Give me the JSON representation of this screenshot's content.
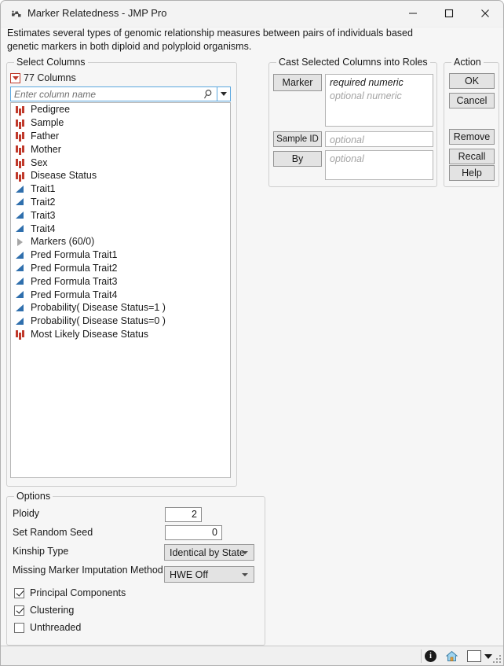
{
  "window": {
    "title": "Marker Relatedness - JMP Pro",
    "app_icon": "jmp-marker-icon",
    "minimize_label": "–",
    "maximize_label": "□",
    "close_label": "✕"
  },
  "description": "Estimates several types of genomic relationship measures between pairs of individuals based genetic markers in both diploid and polyploid organisms.",
  "select_columns": {
    "group_title": "Select Columns",
    "columns_count_label": "77 Columns",
    "search": {
      "placeholder": "Enter column name",
      "value": ""
    },
    "items": [
      {
        "label": "Pedigree",
        "type": "nominal"
      },
      {
        "label": "Sample",
        "type": "nominal"
      },
      {
        "label": "Father",
        "type": "nominal"
      },
      {
        "label": "Mother",
        "type": "nominal"
      },
      {
        "label": "Sex",
        "type": "nominal"
      },
      {
        "label": "Disease Status",
        "type": "nominal"
      },
      {
        "label": "Trait1",
        "type": "continuous"
      },
      {
        "label": "Trait2",
        "type": "continuous"
      },
      {
        "label": "Trait3",
        "type": "continuous"
      },
      {
        "label": "Trait4",
        "type": "continuous"
      },
      {
        "label": "Markers (60/0)",
        "type": "group"
      },
      {
        "label": "Pred Formula Trait1",
        "type": "continuous"
      },
      {
        "label": "Pred Formula Trait2",
        "type": "continuous"
      },
      {
        "label": "Pred Formula Trait3",
        "type": "continuous"
      },
      {
        "label": "Pred Formula Trait4",
        "type": "continuous"
      },
      {
        "label": "Probability( Disease Status=1 )",
        "type": "continuous"
      },
      {
        "label": "Probability( Disease Status=0 )",
        "type": "continuous"
      },
      {
        "label": "Most Likely Disease Status",
        "type": "nominal"
      }
    ]
  },
  "cast_roles": {
    "group_title": "Cast Selected Columns into Roles",
    "marker": {
      "button_label": "Marker",
      "hint_required": "required numeric",
      "hint_optional": "optional numeric",
      "value": ""
    },
    "sample_id": {
      "button_label": "Sample ID",
      "hint": "optional",
      "value": ""
    },
    "by": {
      "button_label": "By",
      "hint": "optional",
      "value": ""
    }
  },
  "action": {
    "group_title": "Action",
    "ok": "OK",
    "cancel": "Cancel",
    "remove": "Remove",
    "recall": "Recall",
    "help": "Help"
  },
  "options": {
    "group_title": "Options",
    "ploidy": {
      "label": "Ploidy",
      "value": "2"
    },
    "random_seed": {
      "label": "Set Random Seed",
      "value": "0"
    },
    "kinship_type": {
      "label": "Kinship Type",
      "value": "Identical by State"
    },
    "imputation_method": {
      "label": "Missing Marker Imputation Method",
      "value": "HWE Off"
    },
    "checkboxes": [
      {
        "label": "Principal Components",
        "checked": true
      },
      {
        "label": "Clustering",
        "checked": true
      },
      {
        "label": "Unthreaded",
        "checked": false
      }
    ]
  },
  "statusbar": {
    "info_icon": "info-icon",
    "info_glyph": "i",
    "home_icon": "home-icon",
    "color_swatch": "#ffffff",
    "resize_grip": "resize-grip"
  },
  "colors": {
    "nominal_icon": "#c0392b",
    "continuous_icon": "#2f6fad",
    "focus_border": "#5aa7df",
    "window_bg": "#f6f6f6"
  }
}
